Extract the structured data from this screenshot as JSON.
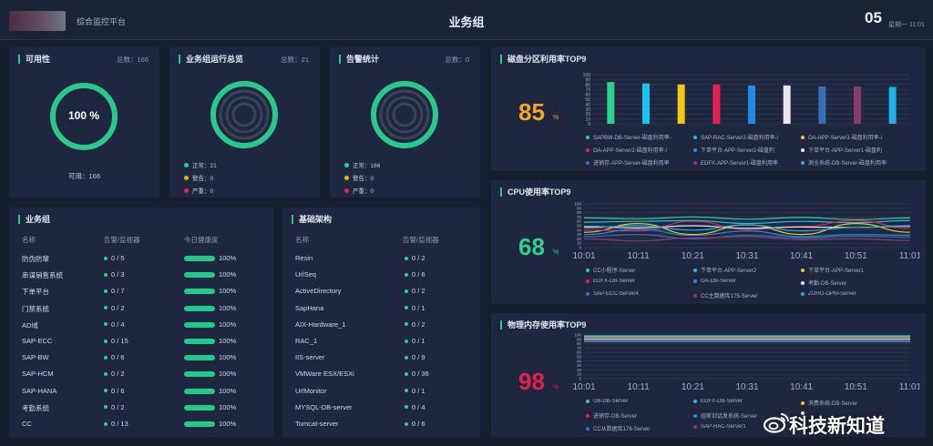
{
  "header": {
    "platform": "综合监控平台",
    "title": "业务组",
    "clock_big": "05",
    "clock_small": "星期一 11:01"
  },
  "availability": {
    "title": "可用性",
    "count": "总数：166",
    "ring_value": "100 %",
    "bottom": "可用：166"
  },
  "group_status": {
    "title": "业务组运行总览",
    "count": "总数：21",
    "stats": [
      {
        "label": "正常：21",
        "color": "#2fd08f"
      },
      {
        "label": "警告：0",
        "color": "#f5a623"
      },
      {
        "label": "严重：0",
        "color": "#e5204e"
      }
    ]
  },
  "alert_stats": {
    "title": "告警统计",
    "count": "总数：0",
    "stats": [
      {
        "label": "正常：166",
        "color": "#2fd08f"
      },
      {
        "label": "警告：0",
        "color": "#f5a623"
      },
      {
        "label": "严重：0",
        "color": "#e5204e"
      }
    ]
  },
  "business": {
    "title": "业务组",
    "headers": [
      "名称",
      "告警/监视器",
      "今日健康度"
    ],
    "rows": [
      {
        "name": "防伪防窜",
        "alerts": "0 / 5",
        "health": "100%"
      },
      {
        "name": "串谋销售系统",
        "alerts": "0 / 3",
        "health": "100%"
      },
      {
        "name": "下单平台",
        "alerts": "0 / 7",
        "health": "100%"
      },
      {
        "name": "门禁系统",
        "alerts": "0 / 2",
        "health": "100%"
      },
      {
        "name": "AD域",
        "alerts": "0 / 4",
        "health": "100%"
      },
      {
        "name": "SAP-ECC",
        "alerts": "0 / 15",
        "health": "100%"
      },
      {
        "name": "SAP-BW",
        "alerts": "0 / 6",
        "health": "100%"
      },
      {
        "name": "SAP-HCM",
        "alerts": "0 / 2",
        "health": "100%"
      },
      {
        "name": "SAP-HANA",
        "alerts": "0 / 6",
        "health": "100%"
      },
      {
        "name": "考勤系统",
        "alerts": "0 / 2",
        "health": "100%"
      },
      {
        "name": "CC",
        "alerts": "0 / 13",
        "health": "100%"
      }
    ]
  },
  "infra": {
    "title": "基础架构",
    "headers": [
      "名称",
      "告警/监视器"
    ],
    "rows": [
      {
        "name": "Resin",
        "alerts": "0 / 2"
      },
      {
        "name": "UrlSeq",
        "alerts": "0 / 6"
      },
      {
        "name": "ActiveDirectory",
        "alerts": "0 / 2"
      },
      {
        "name": "SapHana",
        "alerts": "0 / 1"
      },
      {
        "name": "AIX-Hardware_1",
        "alerts": "0 / 2"
      },
      {
        "name": "RAC_1",
        "alerts": "0 / 1"
      },
      {
        "name": "IIS-server",
        "alerts": "0 / 9"
      },
      {
        "name": "VMWare ESX/ESXi",
        "alerts": "0 / 36"
      },
      {
        "name": "UrlMonitor",
        "alerts": "0 / 1"
      },
      {
        "name": "MYSQL-DB-server",
        "alerts": "0 / 4"
      },
      {
        "name": "Tomcat-server",
        "alerts": "0 / 6"
      }
    ]
  },
  "disk": {
    "title": "磁盘分区利用率TOP9",
    "big_value": "85",
    "pct": "%",
    "big_color": "#f5a623",
    "legend": [
      {
        "label": "SAPBW-DB-Server-磁盘利用率-",
        "color": "#2fd08f"
      },
      {
        "label": "SAP-RAC-Server2-磁盘利用率-/",
        "color": "#17c3e8"
      },
      {
        "label": "OA-APP-Server1-磁盘利用率-/",
        "color": "#f5c518"
      },
      {
        "label": "OA-APP-Server2-磁盘利用率-/",
        "color": "#e5204e"
      },
      {
        "label": "下单平台-APP-Server2-磁盘利",
        "color": "#1f8de6"
      },
      {
        "label": "下单平台-APP-Server1-磁盘利",
        "color": "#e8e8ee"
      },
      {
        "label": "进销存-APP-Server-磁盘利用率",
        "color": "#3a6fb5"
      },
      {
        "label": "EDFX-APP-Server1-磁盘利用率",
        "color": "#8a3a6a"
      },
      {
        "label": "测全系统-DB-Server-磁盘利用率",
        "color": "#1fb0e8"
      }
    ]
  },
  "cpu": {
    "title": "CPU使用率TOP9",
    "big_value": "68",
    "pct": "%",
    "big_color": "#2fd08f",
    "legend": [
      {
        "label": "CC小程序-Server",
        "color": "#2fd08f"
      },
      {
        "label": "下单平台-APP-Server2",
        "color": "#17c3e8"
      },
      {
        "label": "下单平台-APP-Server1",
        "color": "#f5c518"
      },
      {
        "label": "EDFX-DB-Server",
        "color": "#e5204e"
      },
      {
        "label": "OA-DB-Server",
        "color": "#1f8de6"
      },
      {
        "label": "考勤-DB-Server",
        "color": "#e8e8ee"
      },
      {
        "label": "SAP-ECC-Server4",
        "color": "#3a6fb5"
      },
      {
        "label": "CC主数据库175-Server",
        "color": "#8a3a6a"
      },
      {
        "label": "ZOHO-OPM-Server",
        "color": "#1fb0e8"
      }
    ]
  },
  "mem": {
    "title": "物理内存使用率TOP9",
    "big_value": "98",
    "pct": "%",
    "big_color": "#e5204e",
    "legend": [
      {
        "label": "UB-DB-Server",
        "color": "#2fd08f"
      },
      {
        "label": "EDFX-DB-Server",
        "color": "#17c3e8"
      },
      {
        "label": "消费系统-DB-Server",
        "color": "#f5c518"
      },
      {
        "label": "进销存-DB-Server",
        "color": "#e5204e"
      },
      {
        "label": "挂断训话发系统-Server",
        "color": "#1f8de6"
      },
      {
        "label": "",
        "color": "#e8e8ee"
      },
      {
        "label": "CC从数据库176-Server",
        "color": "#3a6fb5"
      },
      {
        "label": "SAP-RAC-Server1",
        "color": "#8a3a6a"
      },
      {
        "label": "",
        "color": "#1fb0e8"
      }
    ]
  },
  "chart_data": [
    {
      "type": "bar",
      "title": "磁盘分区利用率TOP9",
      "categories": [
        "SAPBW-DB-Server",
        "SAP-RAC-Server2",
        "OA-APP-Server1",
        "OA-APP-Server2",
        "下单平台-APP-Server2",
        "下单平台-APP-Server1",
        "进销存-APP-Server",
        "EDFX-APP-Server1",
        "测全系统-DB-Server"
      ],
      "values": [
        85,
        82,
        80,
        80,
        78,
        78,
        76,
        76,
        75
      ],
      "colors": [
        "#2fd08f",
        "#17c3e8",
        "#f5c518",
        "#e5204e",
        "#1f8de6",
        "#e8e8ee",
        "#3a6fb5",
        "#8a3a6a",
        "#1fb0e8"
      ],
      "ylim": [
        0,
        100
      ],
      "yticks": [
        0,
        10,
        20,
        30,
        40,
        50,
        60,
        70,
        80,
        90,
        100
      ]
    },
    {
      "type": "line",
      "title": "CPU使用率TOP9",
      "x": [
        "10:01",
        "10:11",
        "10:21",
        "10:31",
        "10:41",
        "10:51",
        "11:01"
      ],
      "ylim": [
        0,
        100
      ],
      "yticks": [
        0,
        10,
        20,
        30,
        40,
        50,
        60,
        70,
        80,
        90,
        100
      ],
      "series": [
        {
          "name": "CC小程序-Server",
          "color": "#2fd08f",
          "values": [
            68,
            66,
            70,
            65,
            69,
            64,
            68
          ]
        },
        {
          "name": "下单平台-APP-Server2",
          "color": "#17c3e8",
          "values": [
            58,
            60,
            62,
            55,
            60,
            57,
            62
          ]
        },
        {
          "name": "下单平台-APP-Server1",
          "color": "#f5c518",
          "values": [
            35,
            55,
            30,
            52,
            30,
            55,
            35
          ]
        },
        {
          "name": "EDFX-DB-Server",
          "color": "#e5204e",
          "values": [
            40,
            38,
            60,
            42,
            48,
            62,
            45
          ]
        },
        {
          "name": "OA-DB-Server",
          "color": "#1f8de6",
          "values": [
            30,
            42,
            28,
            38,
            25,
            30,
            28
          ]
        },
        {
          "name": "考勤-DB-Server",
          "color": "#e8e8ee",
          "values": [
            48,
            45,
            50,
            44,
            47,
            46,
            49
          ]
        },
        {
          "name": "SAP-ECC-Server4",
          "color": "#3a6fb5",
          "values": [
            25,
            30,
            20,
            28,
            22,
            26,
            24
          ]
        },
        {
          "name": "CC主数据库175-Server",
          "color": "#8a3a6a",
          "values": [
            20,
            15,
            22,
            25,
            18,
            20,
            16
          ]
        },
        {
          "name": "ZOHO-OPM-Server",
          "color": "#1fb0e8",
          "values": [
            45,
            50,
            40,
            52,
            38,
            46,
            50
          ]
        }
      ]
    },
    {
      "type": "line",
      "title": "物理内存使用率TOP9",
      "x": [
        "10:01",
        "10:11",
        "10:21",
        "10:31",
        "10:41",
        "10:51",
        "11:01"
      ],
      "ylim": [
        0,
        100
      ],
      "yticks": [
        0,
        10,
        20,
        30,
        40,
        50,
        60,
        70,
        80,
        90,
        100
      ],
      "series": [
        {
          "name": "UB-DB-Server",
          "color": "#2fd08f",
          "values": [
            98,
            98,
            98,
            98,
            98,
            98,
            98
          ]
        },
        {
          "name": "EDFX-DB-Server",
          "color": "#17c3e8",
          "values": [
            96,
            96,
            96,
            96,
            96,
            96,
            96
          ]
        },
        {
          "name": "消费系统-DB-Server",
          "color": "#f5c518",
          "values": [
            94,
            94,
            94,
            94,
            94,
            94,
            94
          ]
        },
        {
          "name": "进销存-DB-Server",
          "color": "#e5204e",
          "values": [
            93,
            93,
            93,
            93,
            93,
            93,
            93
          ]
        },
        {
          "name": "挂断训话发系统-Server",
          "color": "#1f8de6",
          "values": [
            91,
            91,
            91,
            91,
            91,
            91,
            91
          ]
        },
        {
          "name": "",
          "color": "#e8e8ee",
          "values": [
            90,
            90,
            90,
            90,
            90,
            90,
            90
          ]
        },
        {
          "name": "CC从数据库176-Server",
          "color": "#3a6fb5",
          "values": [
            88,
            88,
            88,
            88,
            88,
            88,
            88
          ]
        },
        {
          "name": "SAP-RAC-Server1",
          "color": "#8a3a6a",
          "values": [
            87,
            87,
            87,
            87,
            87,
            87,
            87
          ]
        },
        {
          "name": "",
          "color": "#1fb0e8",
          "values": [
            85,
            85,
            85,
            85,
            85,
            85,
            85
          ]
        }
      ]
    }
  ],
  "watermark": {
    "text": "科技新知道"
  }
}
